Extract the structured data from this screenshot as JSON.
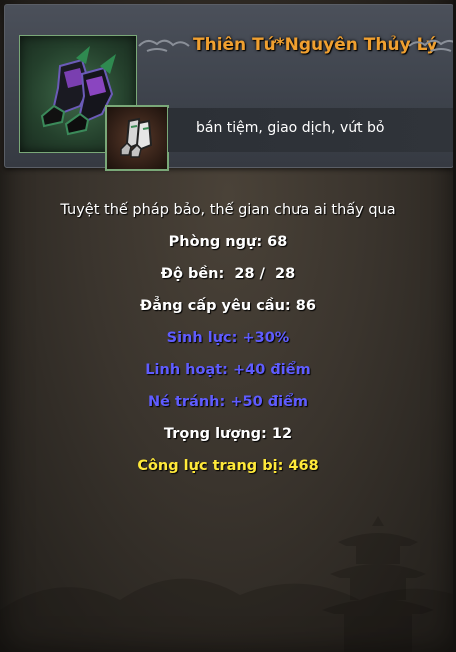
{
  "item": {
    "name": "Thiên Tứ*Nguyên Thủy Lý",
    "big_icon": "boots-icon",
    "small_icon": "boots-small-icon",
    "actions": "bán tiệm, giao dịch, vứt bỏ"
  },
  "stats": [
    {
      "text": "Tuyệt thế pháp bảo, thế gian chưa ai thấy qua",
      "color": "white"
    },
    {
      "text": "Phòng ngự: 68",
      "color": "white"
    },
    {
      "text": "Độ bền:  28 /  28",
      "color": "white"
    },
    {
      "text": "Đẳng cấp yêu cầu: 86",
      "color": "white"
    },
    {
      "text": "Sinh lực: +30%",
      "color": "blue"
    },
    {
      "text": "Linh hoạt: +40 điểm",
      "color": "blue"
    },
    {
      "text": "Né tránh: +50 điểm",
      "color": "blue"
    },
    {
      "text": "Trọng lượng: 12",
      "color": "white"
    },
    {
      "text": "Công lực trang bị: 468",
      "color": "yellow"
    }
  ],
  "colors": {
    "title": "#f0a030",
    "white": "#ffffff",
    "blue": "#5f5cff",
    "yellow": "#ffe93a"
  }
}
